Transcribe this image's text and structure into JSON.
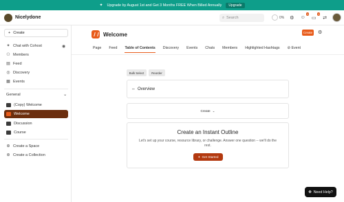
{
  "banner": {
    "text": "Upgrade by August 1st and Get 3 Months FREE When Billed Annually",
    "button": "Upgrade"
  },
  "topbar": {
    "community_name": "Nicelydone",
    "search_placeholder": "Search",
    "progress_label": "0%",
    "notifications_badge": "1",
    "messages_badge": "1"
  },
  "sidebar": {
    "create_label": "Create",
    "items": [
      {
        "label": "Chat with Cohost",
        "icon": "sparkle-icon"
      },
      {
        "label": "Members",
        "icon": "users-icon"
      },
      {
        "label": "Feed",
        "icon": "feed-icon"
      },
      {
        "label": "Discovery",
        "icon": "compass-icon"
      },
      {
        "label": "Events",
        "icon": "calendar-icon"
      }
    ],
    "section_title": "General",
    "section_items": [
      {
        "label": "(Copy) Welcome"
      },
      {
        "label": "Welcome"
      },
      {
        "label": "Discussion"
      },
      {
        "label": "Course"
      }
    ],
    "create_space": "Create a Space",
    "create_collection": "Create a Collection"
  },
  "page": {
    "title": "Welcome",
    "create_button": "Create",
    "tabs": [
      "Page",
      "Feed",
      "Table of Contents",
      "Discovery",
      "Events",
      "Chats",
      "Members",
      "Highlighted Hashtags",
      "Event"
    ],
    "active_tab": "Table of Contents",
    "bulk_select": "Bulk Select",
    "reorder": "Reorder",
    "overview_label": "Overview",
    "create_row_label": "Create",
    "outline_title": "Create an Instant Outline",
    "outline_text": "Let's set up your course, resource library, or challenge. Answer one question -- we'll do the rest.",
    "get_started": "Get Started"
  },
  "help_button": "Need Help?",
  "colors": {
    "banner": "#0e9e8a",
    "accent": "#e85b1a",
    "active_sidebar": "#6b2e0e"
  }
}
